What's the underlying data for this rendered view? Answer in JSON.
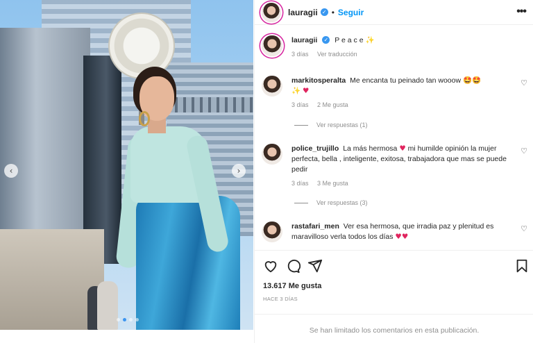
{
  "post": {
    "username": "lauragii",
    "verified_mark": "✓",
    "follow_label": "Seguir",
    "more_label": "•••",
    "caption_text": "P e a c e",
    "caption_emoji": "✨",
    "caption_time": "3 días",
    "translate_label": "Ver traducción",
    "nav_prev": "‹",
    "nav_next": "›"
  },
  "comments": [
    {
      "username": "markitosperalta",
      "text": "Me encanta tu peinado tan wooow",
      "emojis_a": "🤩🤩",
      "emojis_b": "✨",
      "heart": "♥",
      "time": "3 días",
      "likes": "2 Me gusta",
      "replies": "Ver respuestas (1)"
    },
    {
      "username": "police_trujillo",
      "text": "La más hermosa",
      "heart": "♥",
      "text2": "mi humilde opinión la mujer perfecta, bella , inteligente, exitosa, trabajadora que mas se puede pedir",
      "time": "3 días",
      "likes": "3 Me gusta",
      "replies": "Ver respuestas (3)"
    },
    {
      "username": "rastafari_men",
      "text": "Ver esa hermosa, que irradia paz y plenitud es maravilloso verla todos los días",
      "hearts": "♥♥"
    }
  ],
  "actions": {
    "likes": "13.617 Me gusta",
    "posted_ago": "HACE 3 DÍAS",
    "comments_limited": "Se han limitado los comentarios en esta publicación."
  },
  "colors": {
    "accent": "#0095f6",
    "verified": "#3897f0",
    "heart": "#e0245e",
    "muted": "#8e8e8e"
  }
}
